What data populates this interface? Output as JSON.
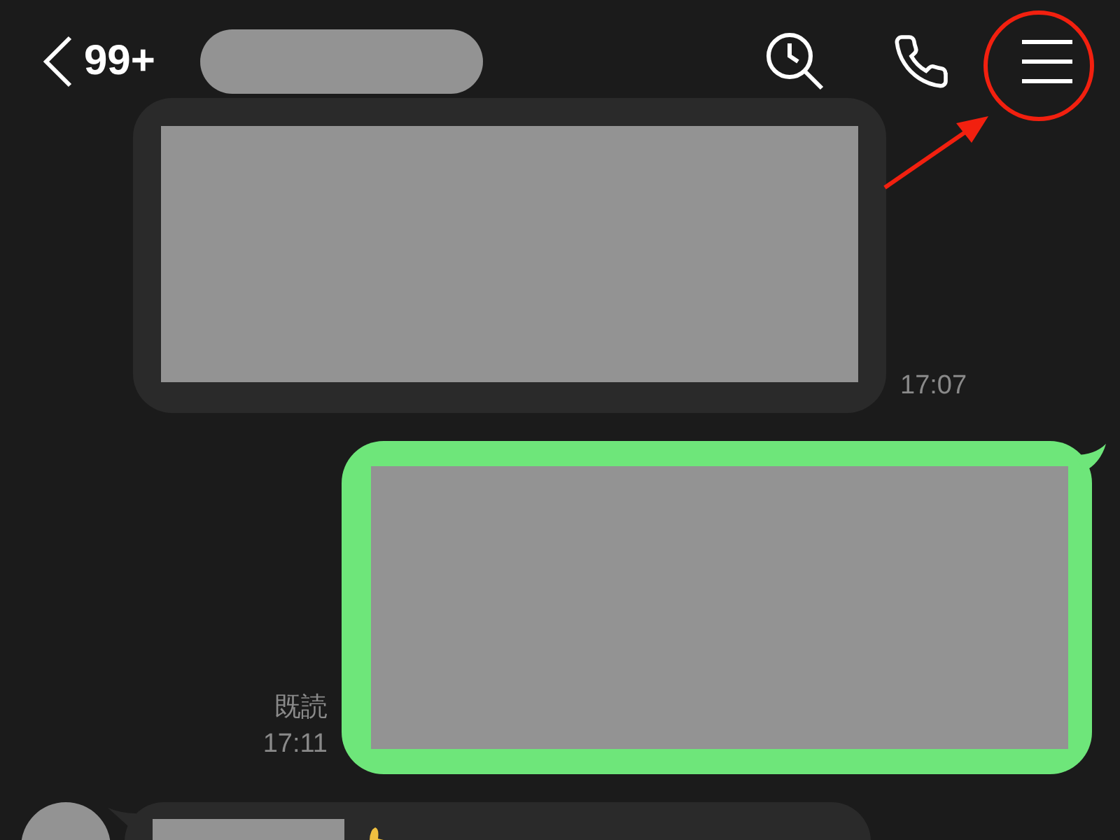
{
  "header": {
    "back_label": "99+"
  },
  "messages": [
    {
      "kind": "incoming",
      "time": "17:07",
      "avatar": false,
      "emoji": false
    },
    {
      "kind": "outgoing",
      "time": "17:11",
      "read": "既読"
    },
    {
      "kind": "incoming",
      "avatar": true,
      "emoji": true
    }
  ]
}
